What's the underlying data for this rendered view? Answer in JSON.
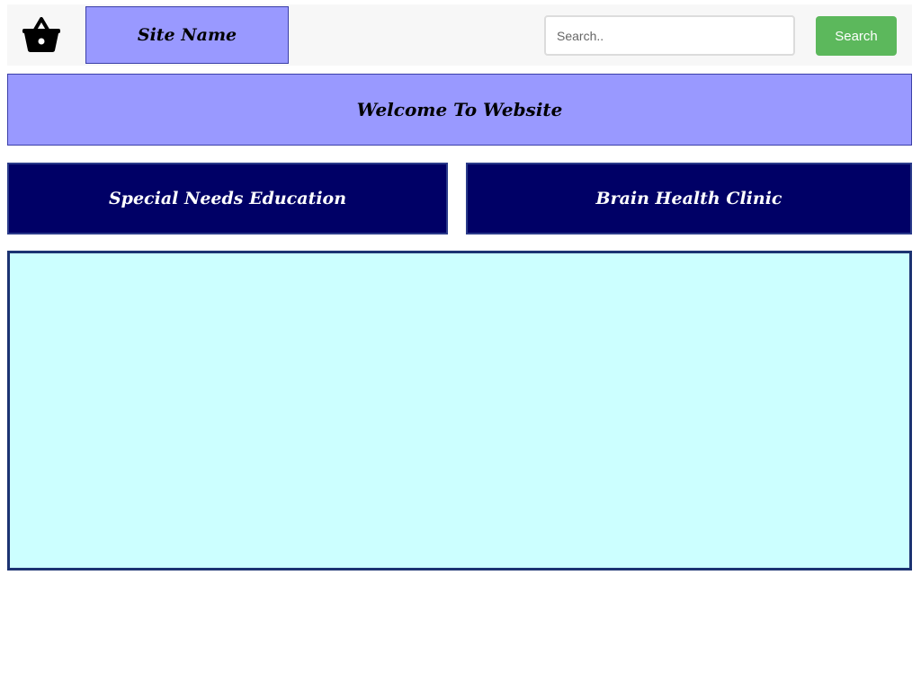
{
  "header": {
    "cart_icon": "shopping-basket-icon",
    "site_name": "Site Name",
    "search": {
      "placeholder": "Search..",
      "value": "",
      "button_label": "Search"
    }
  },
  "banner": {
    "title": "Welcome To Website"
  },
  "cards": [
    {
      "label": "Special Needs Education"
    },
    {
      "label": "Brain Health Clinic"
    }
  ],
  "colors": {
    "accent": "#9999ff",
    "navy": "#000066",
    "search_button": "#5cb85c",
    "panel": "#ccffff",
    "panel_border": "#1c3372"
  }
}
